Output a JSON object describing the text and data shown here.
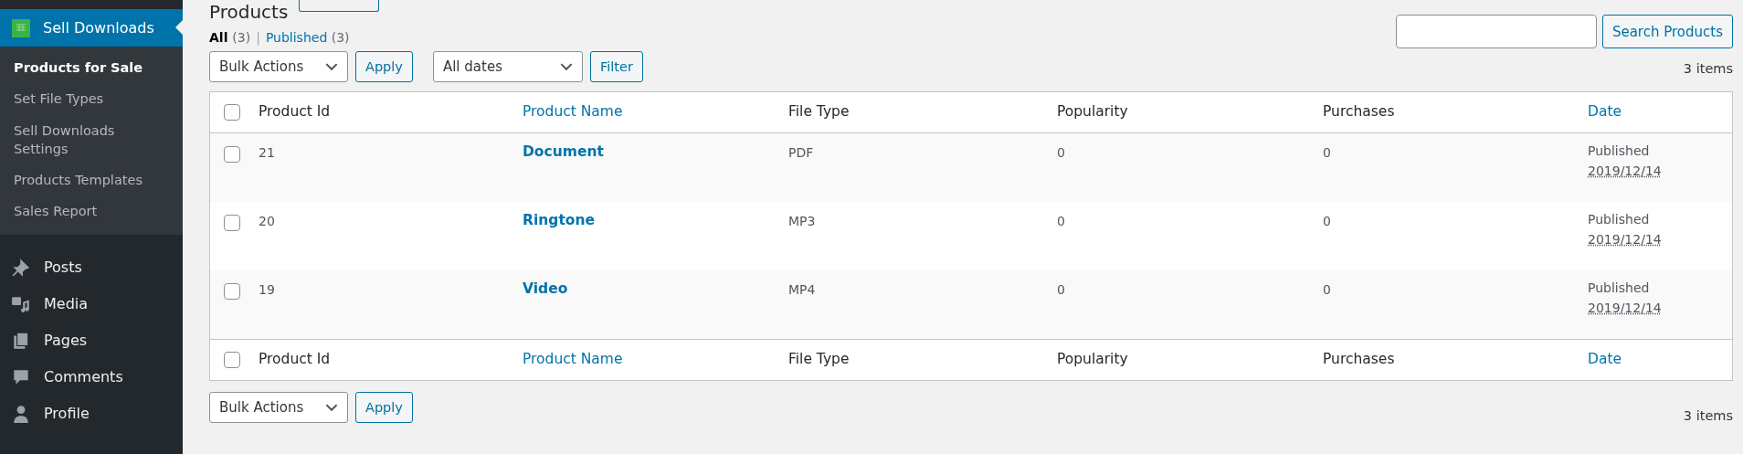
{
  "sidebar": {
    "active": {
      "label": "Sell Downloads"
    },
    "submenu": [
      {
        "label": "Products for Sale",
        "selected": true
      },
      {
        "label": "Set File Types",
        "selected": false
      },
      {
        "label": "Sell Downloads Settings",
        "selected": false
      },
      {
        "label": "Products Templates",
        "selected": false
      },
      {
        "label": "Sales Report",
        "selected": false
      }
    ],
    "menu": [
      {
        "label": "Posts"
      },
      {
        "label": "Media"
      },
      {
        "label": "Pages"
      },
      {
        "label": "Comments"
      },
      {
        "label": "Profile"
      }
    ]
  },
  "page": {
    "title": "Products"
  },
  "views": [
    {
      "label": "All",
      "count": "(3)",
      "selected": true
    },
    {
      "label": "Published",
      "count": "(3)",
      "selected": false
    }
  ],
  "view_separator": "|",
  "search": {
    "button": "Search Products"
  },
  "top_actions": {
    "bulk": "Bulk Actions",
    "apply": "Apply",
    "dates": "All dates",
    "filter": "Filter",
    "count": "3 items"
  },
  "table": {
    "header_checked": false,
    "footer_checked": false,
    "columns": [
      {
        "label": "Product Id",
        "sortable": false
      },
      {
        "label": "Product Name",
        "sortable": true
      },
      {
        "label": "File Type",
        "sortable": false
      },
      {
        "label": "Popularity",
        "sortable": false
      },
      {
        "label": "Purchases",
        "sortable": false
      },
      {
        "label": "Date",
        "sortable": true
      }
    ],
    "rows": [
      {
        "checked": false,
        "cells": [
          "21",
          "Document",
          "PDF",
          "0",
          "0"
        ],
        "status": "Published",
        "date": "2019/12/14"
      },
      {
        "checked": false,
        "cells": [
          "20",
          "Ringtone",
          "MP3",
          "0",
          "0"
        ],
        "status": "Published",
        "date": "2019/12/14"
      },
      {
        "checked": false,
        "cells": [
          "19",
          "Video",
          "MP4",
          "0",
          "0"
        ],
        "status": "Published",
        "date": "2019/12/14"
      }
    ],
    "footer_columns": [
      {
        "label": "Product Id",
        "sortable": false
      },
      {
        "label": "Product Name",
        "sortable": true
      },
      {
        "label": "File Type",
        "sortable": false
      },
      {
        "label": "Popularity",
        "sortable": false
      },
      {
        "label": "Purchases",
        "sortable": false
      },
      {
        "label": "Date",
        "sortable": true
      }
    ]
  },
  "bottom_actions": {
    "bulk": "Bulk Actions",
    "apply": "Apply",
    "count": "3 items"
  }
}
